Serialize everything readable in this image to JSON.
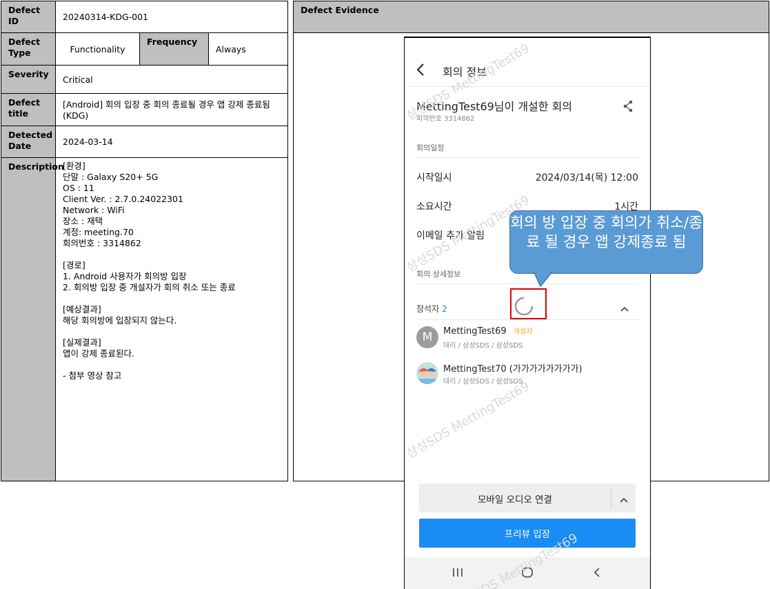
{
  "defect": {
    "id_label": "Defect ID",
    "id_value": "20240314-KDG-001",
    "type_label": "Defect Type",
    "type_value": "Functionality",
    "frequency_label": "Frequency",
    "frequency_value": "Always",
    "severity_label": "Severity",
    "severity_value": "Critical",
    "title_label": "Defect title",
    "title_value": "[Android] 회의 입장 중 회의 종료될 경우 앱 강제 종료됨 (KDG)",
    "date_label": "Detected Date",
    "date_value": "2024-03-14",
    "description_label": "Description",
    "description_lines": [
      "[환경]",
      "단말 : Galaxy S20+ 5G",
      "OS : 11",
      "Client Ver. : 2.7.0.24022301",
      "Network : WiFi",
      "장소 : 재택",
      "계정: meeting.70",
      "회의번호 : 3314862",
      "",
      "[경로]",
      "1.   Android 사용자가 회의방 입장",
      "2.   회의방 입장 중 개설자가 회의 취소 또는 종료",
      "",
      "[예상결과]",
      "해당 회의방에 입장되지 않는다.",
      "",
      "[실제결과]",
      "앱이 강제 종료된다.",
      "",
      "-    첨부 영상 참고"
    ]
  },
  "evidence": {
    "label": "Defect Evidence"
  },
  "phone": {
    "header_title": "회의 정보",
    "meeting_title": "MettingTest69님이 개설한 회의",
    "meeting_number": "회의번호 3314862",
    "section_schedule": "회의일정",
    "start_label": "시작일시",
    "start_value": "2024/03/14(목) 12:00",
    "duration_label": "소요시간",
    "duration_value": "1시간",
    "email_label": "이메일 추가 알림",
    "section_detail": "회의 상세정보",
    "participants_label": "참석자",
    "participants_count": "2",
    "participants": [
      {
        "avatar": "M",
        "name": "MettingTest69",
        "badge": "개설자",
        "sub": "대리 / 삼성SDS / 삼성SDS"
      },
      {
        "avatar": "",
        "name": "MettingTest70 (가가가가가가가가)",
        "badge": "",
        "sub": "대리 / 삼성SDS / 삼성SDS"
      }
    ],
    "audio_button": "모바일 오디오 연결",
    "preview_button": "프리뷰 입장",
    "accent_color": "#1a8cf3",
    "badge_color": "#f5a623",
    "watermark_text": "삼성SDS MettingTest69"
  },
  "callout": {
    "text": "회의 방 입장 중 회의가 취소/종료 될 경우 앱 강제종료 됨"
  }
}
